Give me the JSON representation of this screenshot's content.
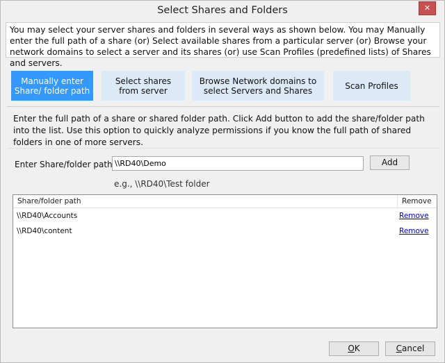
{
  "window": {
    "title": "Select Shares and Folders",
    "close_label": "✕"
  },
  "intro": {
    "text": "You may select your server shares and folders in several ways as shown below. You may Manually enter the full path of a share (or) Select available shares from a particular server (or) Browse your network domains to select a server and its shares (or) use Scan Profiles (predefined lists) of Shares and servers."
  },
  "tabs": [
    {
      "label": "Manually enter Share/ folder path",
      "active": true
    },
    {
      "label": "Select shares from server",
      "active": false
    },
    {
      "label": "Browse Network domains to select Servers and Shares",
      "active": false
    },
    {
      "label": "Scan Profiles",
      "active": false
    }
  ],
  "manual": {
    "description": "Enter the full path of a share or shared folder path. Click Add button to add the share/folder path into the list. Use this option to quickly analyze permissions if you know the full path of shared folders in one of more servers.",
    "path_label": "Enter Share/folder path:",
    "path_value": "\\\\RD40\\Demo",
    "add_label": "Add",
    "example": "e.g., \\\\RD40\\Test folder"
  },
  "list": {
    "columns": [
      "Share/folder path",
      "Remove"
    ],
    "rows": [
      {
        "path": "\\\\RD40\\Accounts",
        "action": "Remove"
      },
      {
        "path": "\\\\RD40\\content",
        "action": "Remove"
      }
    ]
  },
  "footer": {
    "ok_prefix": "",
    "ok_key": "O",
    "ok_rest": "K",
    "cancel_prefix": "",
    "cancel_key": "C",
    "cancel_rest": "ancel"
  },
  "colors": {
    "active_tab": "#3399ff",
    "inactive_tab": "#dce9f6",
    "close_button": "#c7514f",
    "link": "#0000cc"
  }
}
